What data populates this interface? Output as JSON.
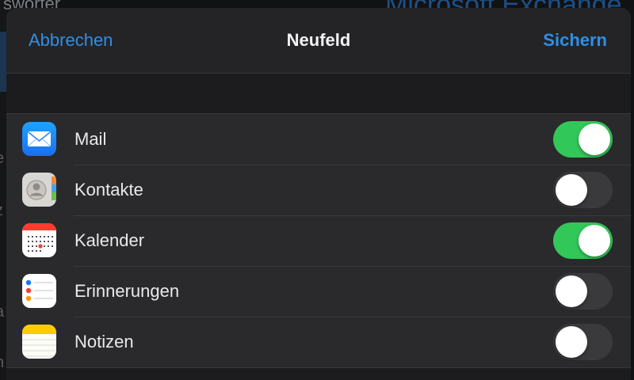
{
  "background": {
    "top_left_text": "sworter",
    "top_right_title": "Microsoft Exchange",
    "edge_chars": [
      "t",
      "e",
      "z",
      "a",
      "h"
    ]
  },
  "navbar": {
    "cancel_label": "Abbrechen",
    "title": "Neufeld",
    "save_label": "Sichern"
  },
  "colors": {
    "accent": "#2f8fe6",
    "toggle_on": "#32c759",
    "toggle_off": "#3a3a3c",
    "sheet_bg": "#1c1c1e",
    "row_bg": "#2a2a2c"
  },
  "items": [
    {
      "label": "Mail",
      "icon": "mail-icon",
      "enabled": true
    },
    {
      "label": "Kontakte",
      "icon": "contacts-icon",
      "enabled": false
    },
    {
      "label": "Kalender",
      "icon": "calendar-icon",
      "enabled": true
    },
    {
      "label": "Erinnerungen",
      "icon": "reminders-icon",
      "enabled": false
    },
    {
      "label": "Notizen",
      "icon": "notes-icon",
      "enabled": false
    }
  ]
}
